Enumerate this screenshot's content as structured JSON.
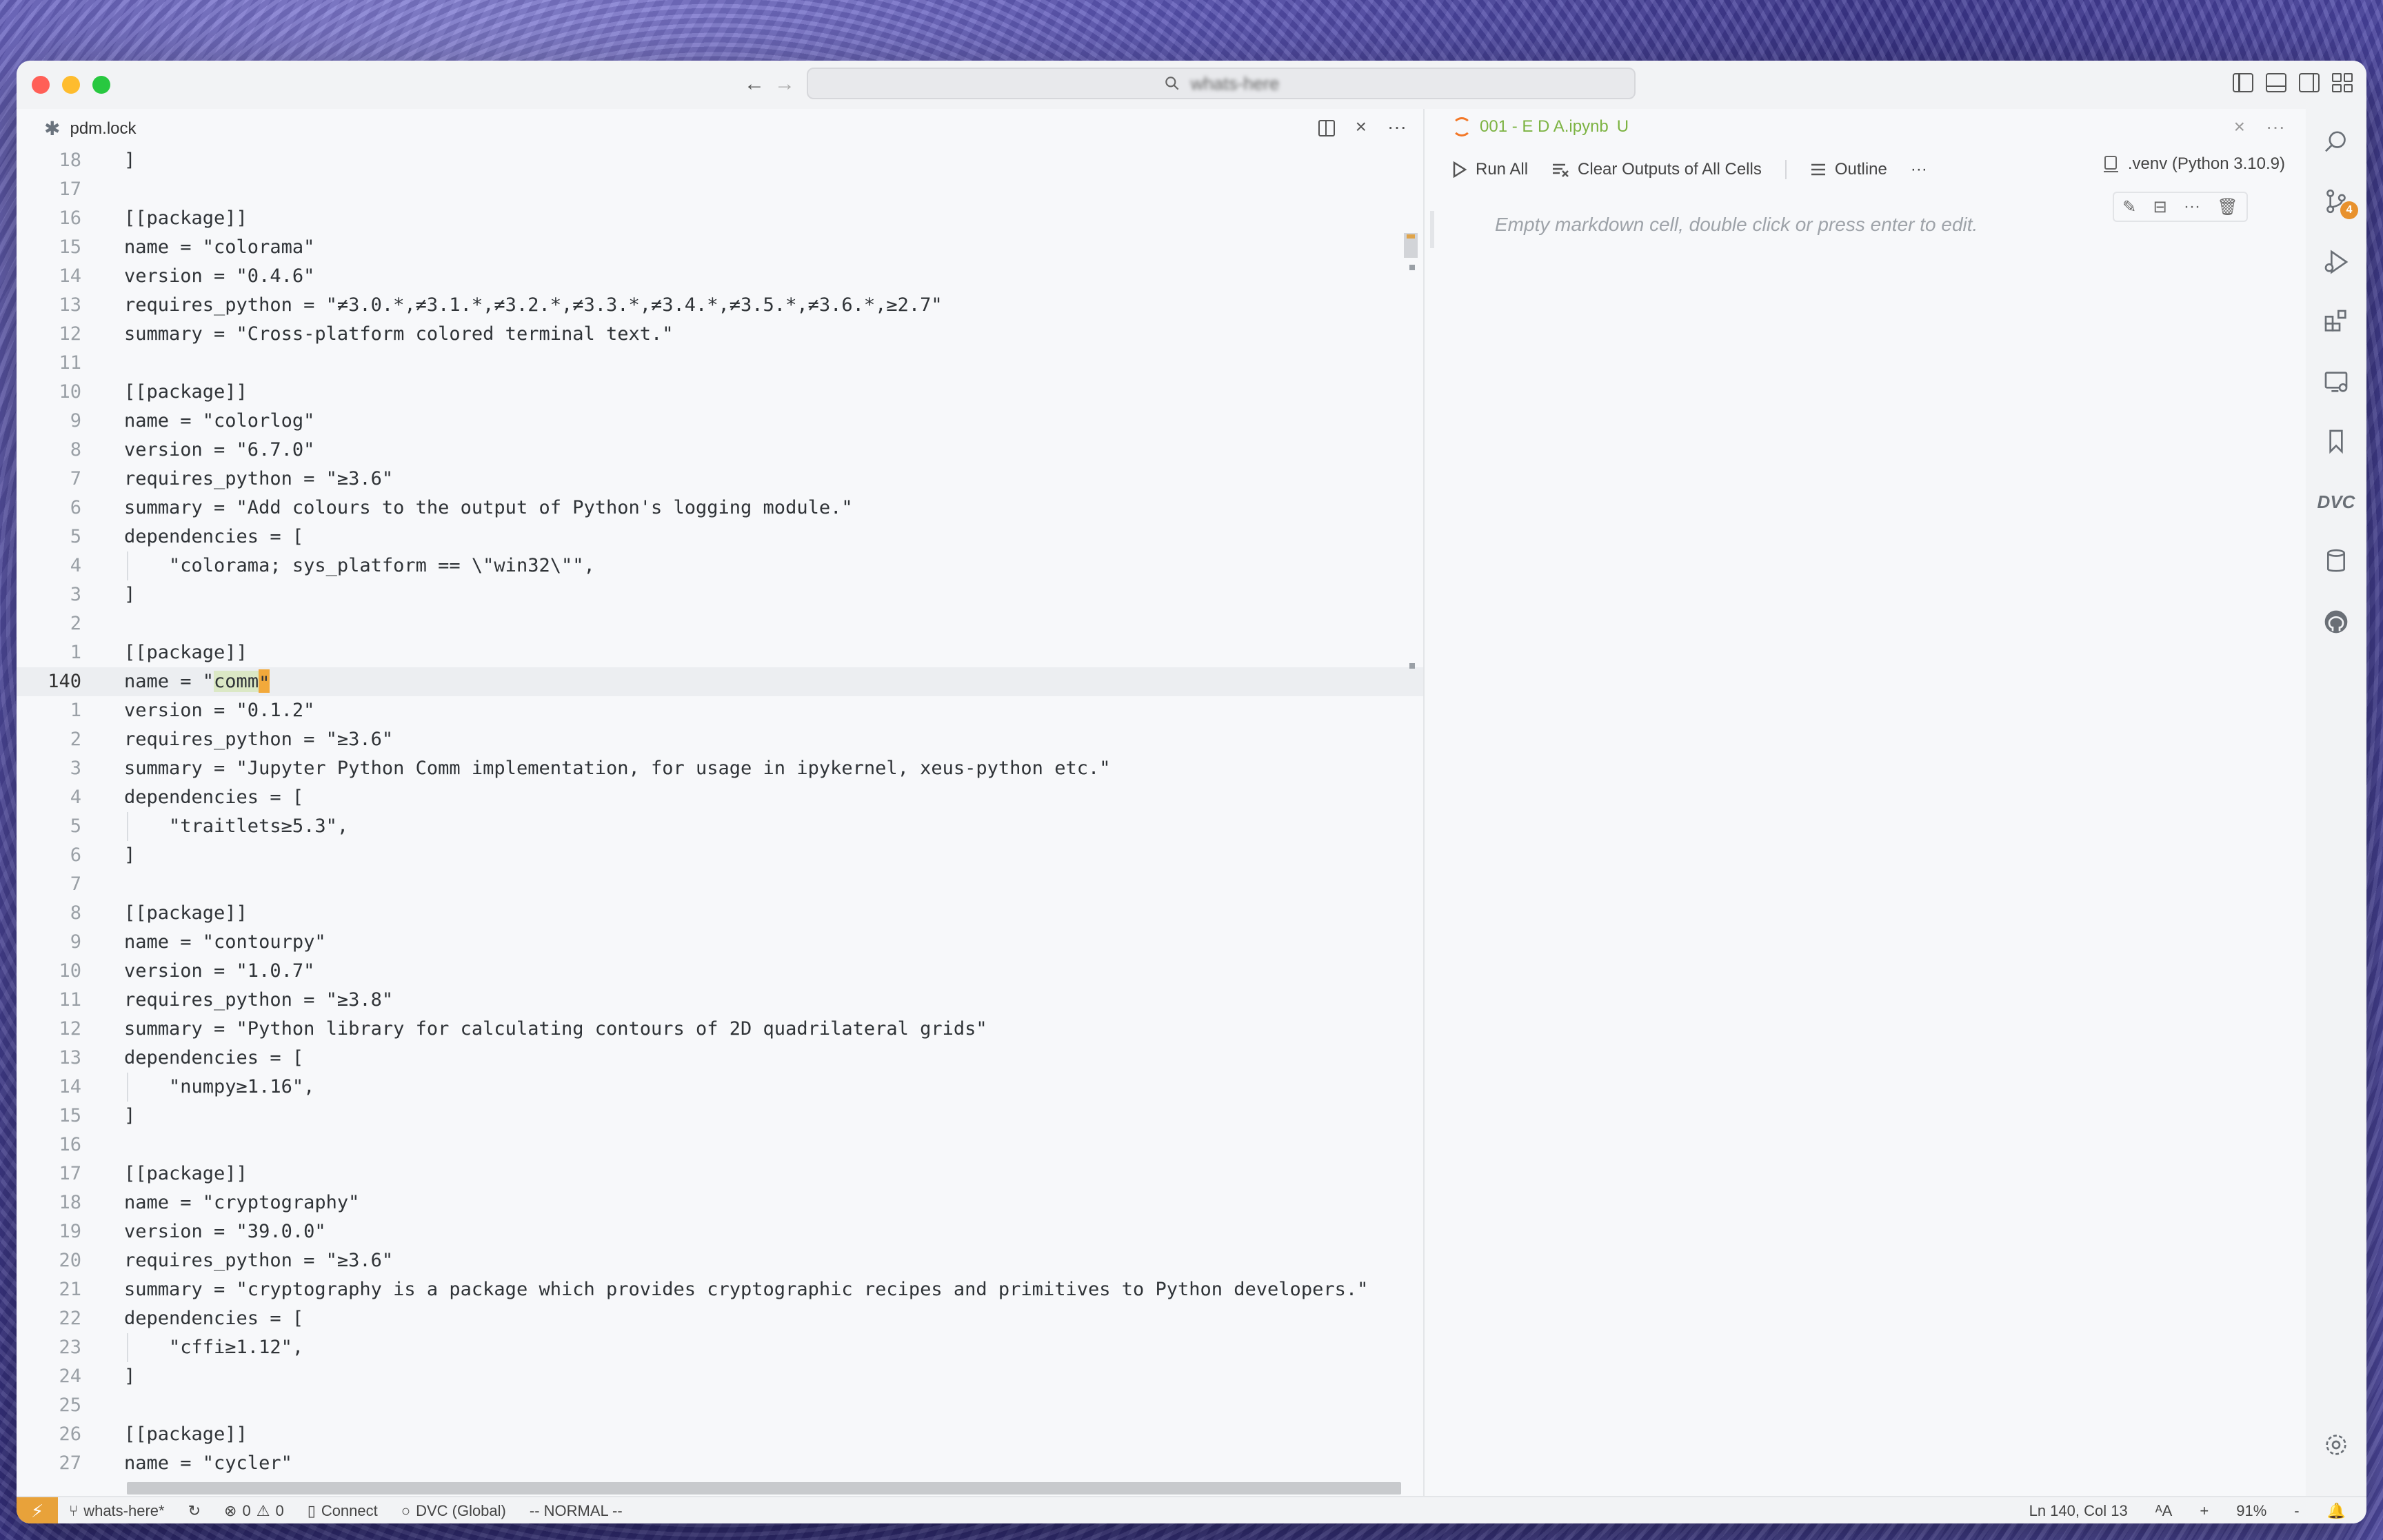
{
  "window": {
    "command_center_text": "whats-here",
    "nav_back": "←",
    "nav_forward": "→"
  },
  "editor_left": {
    "tab_title": "pdm.lock",
    "lines": [
      {
        "n": "18",
        "t": "]"
      },
      {
        "n": "17",
        "t": ""
      },
      {
        "n": "16",
        "t": "[[package]]"
      },
      {
        "n": "15",
        "t": "name = \"colorama\""
      },
      {
        "n": "14",
        "t": "version = \"0.4.6\""
      },
      {
        "n": "13",
        "t": "requires_python = \"≠3.0.*,≠3.1.*,≠3.2.*,≠3.3.*,≠3.4.*,≠3.5.*,≠3.6.*,≥2.7\""
      },
      {
        "n": "12",
        "t": "summary = \"Cross-platform colored terminal text.\""
      },
      {
        "n": "11",
        "t": ""
      },
      {
        "n": "10",
        "t": "[[package]]"
      },
      {
        "n": "9",
        "t": "name = \"colorlog\""
      },
      {
        "n": "8",
        "t": "version = \"6.7.0\""
      },
      {
        "n": "7",
        "t": "requires_python = \"≥3.6\""
      },
      {
        "n": "6",
        "t": "summary = \"Add colours to the output of Python's logging module.\""
      },
      {
        "n": "5",
        "t": "dependencies = ["
      },
      {
        "n": "4",
        "t": "    \"colorama; sys_platform == \\\"win32\\\"\","
      },
      {
        "n": "3",
        "t": "]"
      },
      {
        "n": "2",
        "t": ""
      },
      {
        "n": "1",
        "t": "[[package]]"
      },
      {
        "n": "140",
        "t": "name = \"comm\"",
        "current": true
      },
      {
        "n": "1",
        "t": "version = \"0.1.2\""
      },
      {
        "n": "2",
        "t": "requires_python = \"≥3.6\""
      },
      {
        "n": "3",
        "t": "summary = \"Jupyter Python Comm implementation, for usage in ipykernel, xeus-python etc.\""
      },
      {
        "n": "4",
        "t": "dependencies = ["
      },
      {
        "n": "5",
        "t": "    \"traitlets≥5.3\","
      },
      {
        "n": "6",
        "t": "]"
      },
      {
        "n": "7",
        "t": ""
      },
      {
        "n": "8",
        "t": "[[package]]"
      },
      {
        "n": "9",
        "t": "name = \"contourpy\""
      },
      {
        "n": "10",
        "t": "version = \"1.0.7\""
      },
      {
        "n": "11",
        "t": "requires_python = \"≥3.8\""
      },
      {
        "n": "12",
        "t": "summary = \"Python library for calculating contours of 2D quadrilateral grids\""
      },
      {
        "n": "13",
        "t": "dependencies = ["
      },
      {
        "n": "14",
        "t": "    \"numpy≥1.16\","
      },
      {
        "n": "15",
        "t": "]"
      },
      {
        "n": "16",
        "t": ""
      },
      {
        "n": "17",
        "t": "[[package]]"
      },
      {
        "n": "18",
        "t": "name = \"cryptography\""
      },
      {
        "n": "19",
        "t": "version = \"39.0.0\""
      },
      {
        "n": "20",
        "t": "requires_python = \"≥3.6\""
      },
      {
        "n": "21",
        "t": "summary = \"cryptography is a package which provides cryptographic recipes and primitives to Python developers.\""
      },
      {
        "n": "22",
        "t": "dependencies = ["
      },
      {
        "n": "23",
        "t": "    \"cffi≥1.12\","
      },
      {
        "n": "24",
        "t": "]"
      },
      {
        "n": "25",
        "t": ""
      },
      {
        "n": "26",
        "t": "[[package]]"
      },
      {
        "n": "27",
        "t": "name = \"cycler\""
      }
    ]
  },
  "notebook": {
    "tab_title": "001 - E D A.ipynb",
    "tab_status": "U",
    "toolbar": {
      "run_all": "Run All",
      "clear_outputs": "Clear Outputs of All Cells",
      "outline": "Outline",
      "more": "···"
    },
    "kernel": ".venv (Python 3.10.9)",
    "cell_placeholder": "Empty markdown cell, double click or press enter to edit."
  },
  "activity_bar": {
    "source_control_badge": "4",
    "dvc_label": "DVC"
  },
  "statusbar": {
    "branch": "whats-here*",
    "errors": "0",
    "warnings": "0",
    "connect": "Connect",
    "dvc": "DVC (Global)",
    "mode": "-- NORMAL --",
    "position": "Ln 140, Col 13",
    "zoom": "91%",
    "zoom_in": "+",
    "zoom_out": "-"
  }
}
